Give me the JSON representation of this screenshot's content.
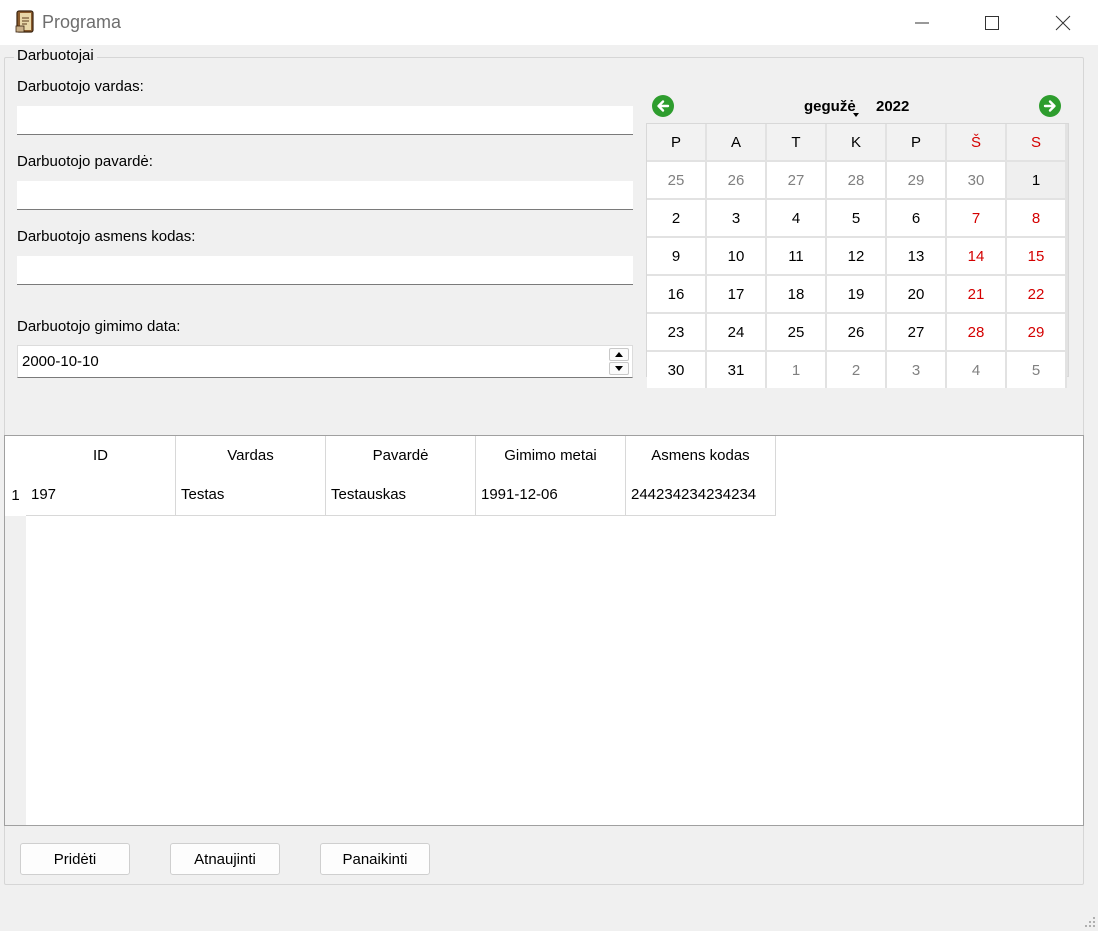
{
  "window": {
    "title": "Programa",
    "icon": "book-icon",
    "controls": [
      "minimize-icon",
      "maximize-icon",
      "close-icon"
    ]
  },
  "group": {
    "title": "Darbuotojai"
  },
  "form": {
    "name_label": "Darbuotojo vardas:",
    "name_value": "",
    "surname_label": "Darbuotojo pavardė:",
    "surname_value": "",
    "code_label": "Darbuotojo asmens kodas:",
    "code_value": "",
    "birth_label": "Darbuotojo gimimo data:",
    "birth_value": "2000-10-10"
  },
  "calendar": {
    "month": "gegužė",
    "year": "2022",
    "selected_day": "1",
    "weekdays": [
      "P",
      "A",
      "T",
      "K",
      "P",
      "Š",
      "S"
    ],
    "weeks": [
      [
        "25",
        "26",
        "27",
        "28",
        "29",
        "30",
        "1"
      ],
      [
        "2",
        "3",
        "4",
        "5",
        "6",
        "7",
        "8"
      ],
      [
        "9",
        "10",
        "11",
        "12",
        "13",
        "14",
        "15"
      ],
      [
        "16",
        "17",
        "18",
        "19",
        "20",
        "21",
        "22"
      ],
      [
        "23",
        "24",
        "25",
        "26",
        "27",
        "28",
        "29"
      ],
      [
        "30",
        "31",
        "1",
        "2",
        "3",
        "4",
        "5"
      ]
    ],
    "weekend_color": "#d40000",
    "other_month_color": "#808080",
    "nav_color": "#2e9d2e"
  },
  "table": {
    "columns": [
      "ID",
      "Vardas",
      "Pavardė",
      "Gimimo metai",
      "Asmens kodas"
    ],
    "row_headers": [
      "1"
    ],
    "rows": [
      [
        "197",
        "Testas",
        "Testauskas",
        "1991-12-06",
        "244234234234234"
      ]
    ]
  },
  "buttons": {
    "add": "Pridėti",
    "refresh": "Atnaujinti",
    "delete": "Panaikinti"
  }
}
